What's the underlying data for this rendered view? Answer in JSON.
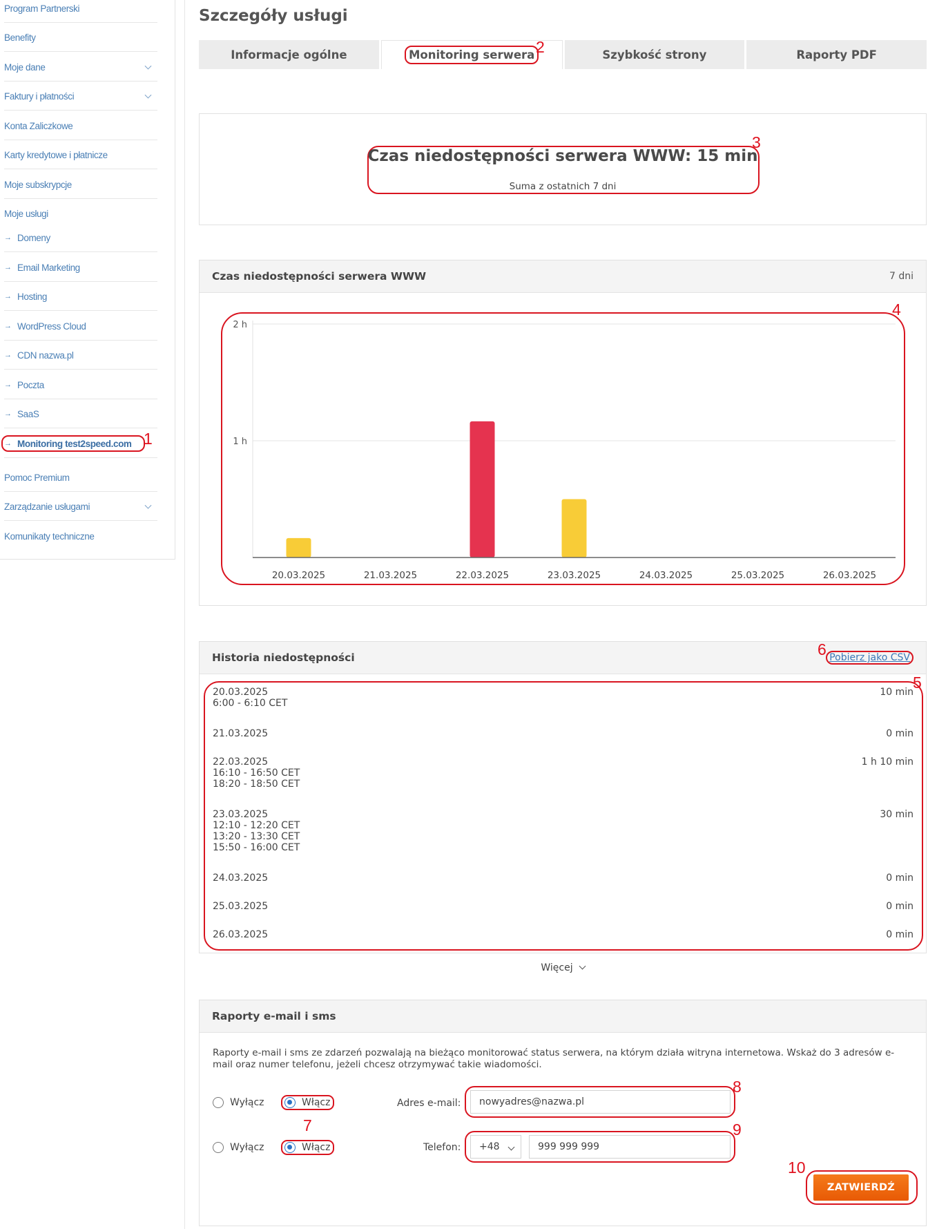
{
  "sidebar": {
    "items": [
      {
        "label": "Program Partnerski"
      },
      {
        "label": "Benefity"
      },
      {
        "label": "Moje dane"
      },
      {
        "label": "Faktury i płatności"
      },
      {
        "label": "Konta Zaliczkowe"
      },
      {
        "label": "Karty kredytowe i płatnicze"
      },
      {
        "label": "Moje subskrypcje"
      },
      {
        "label": "Moje usługi"
      },
      {
        "label": "Domeny"
      },
      {
        "label": "Email Marketing"
      },
      {
        "label": "Hosting"
      },
      {
        "label": "WordPress Cloud"
      },
      {
        "label": "CDN nazwa.pl"
      },
      {
        "label": "Poczta"
      },
      {
        "label": "SaaS"
      },
      {
        "label": "Monitoring test2speed.com"
      },
      {
        "label": "Pomoc Premium"
      },
      {
        "label": "Zarządzanie usługami"
      },
      {
        "label": "Komunikaty techniczne"
      }
    ],
    "arrow": "→"
  },
  "markers": [
    "1",
    "2",
    "3",
    "4",
    "5",
    "6",
    "7",
    "8",
    "9",
    "10"
  ],
  "page": {
    "title": "Szczegóły usługi",
    "tabs": [
      "Informacje ogólne",
      "Monitoring serwera",
      "Szybkość strony",
      "Raporty PDF"
    ],
    "active_tab": "Monitoring serwera"
  },
  "summary": {
    "title": "Czas niedostępności serwera WWW: 15 min",
    "subtitle": "Suma z ostatnich 7 dni"
  },
  "chart_card": {
    "title": "Czas niedostępności serwera WWW",
    "range": "7 dni"
  },
  "chart_data": {
    "type": "bar",
    "categories": [
      "20.03.2025",
      "21.03.2025",
      "22.03.2025",
      "23.03.2025",
      "24.03.2025",
      "25.03.2025",
      "26.03.2025"
    ],
    "values": [
      10,
      0,
      70,
      30,
      0,
      0,
      0
    ],
    "value_unit": "min",
    "colors": [
      "#f8cc37",
      "#f8cc37",
      "#e5334f",
      "#f8cc37",
      "#f8cc37",
      "#f8cc37",
      "#f8cc37"
    ],
    "y_ticks": [
      {
        "value": 60,
        "label": "1 h"
      },
      {
        "value": 120,
        "label": "2 h"
      }
    ],
    "ylim": [
      0,
      120
    ],
    "grid": true
  },
  "history": {
    "title": "Historia niedostępności",
    "csv_link": "Pobierz jako CSV",
    "rows": [
      {
        "date": "20.03.2025",
        "duration": "10 min",
        "periods": [
          "6:00 - 6:10 CET"
        ]
      },
      {
        "date": "21.03.2025",
        "duration": "0 min",
        "periods": []
      },
      {
        "date": "22.03.2025",
        "duration": "1 h 10 min",
        "periods": [
          "16:10 - 16:50 CET",
          "18:20 - 18:50 CET"
        ]
      },
      {
        "date": "23.03.2025",
        "duration": "30 min",
        "periods": [
          "12:10 - 12:20 CET",
          "13:20 - 13:30 CET",
          "15:50 - 16:00 CET"
        ]
      },
      {
        "date": "24.03.2025",
        "duration": "0 min",
        "periods": []
      },
      {
        "date": "25.03.2025",
        "duration": "0 min",
        "periods": []
      },
      {
        "date": "26.03.2025",
        "duration": "0 min",
        "periods": []
      }
    ],
    "more_label": "Więcej"
  },
  "reports": {
    "title": "Raporty e-mail i sms",
    "description": "Raporty e-mail i sms ze zdarzeń pozwalają na bieżąco monitorować status serwera, na którym działa witryna internetowa. Wskaż do 3 adresów e-mail oraz numer telefonu, jeżeli chcesz otrzymywać takie wiadomości.",
    "off_label": "Wyłącz",
    "on_label": "Włącz",
    "email_label": "Adres e-mail:",
    "email_value": "nowyadres@nazwa.pl",
    "phone_label": "Telefon:",
    "phone_prefix": "+48",
    "phone_value": "999 999 999",
    "email_enabled": true,
    "sms_enabled": true,
    "submit_label": "ZATWIERDŹ"
  },
  "colors": {
    "annotation_red": "#d9141f",
    "accent_orange": "#ef6a0f",
    "link_blue": "#4a7fb5",
    "bar_yellow": "#f8cc37",
    "bar_red": "#e5334f"
  }
}
